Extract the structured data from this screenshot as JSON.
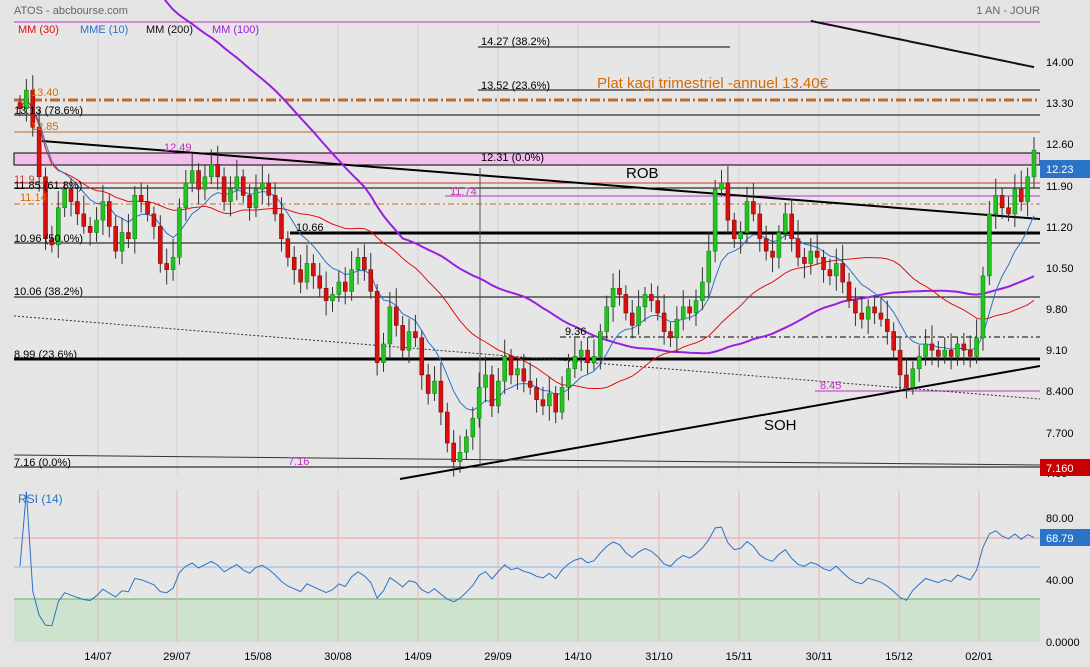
{
  "header": {
    "title": "ATOS - abcbourse.com",
    "period": "1 AN - JOUR"
  },
  "legend": [
    {
      "label": "MM (30)",
      "color": "#e01010"
    },
    {
      "label": "MME (10)",
      "color": "#2a73c8"
    },
    {
      "label": "MM (200)",
      "color": "#111111"
    },
    {
      "label": "MM (100)",
      "color": "#9a1ee0"
    }
  ],
  "price_axis": {
    "ticks": [
      "14.00",
      "13.30",
      "12.60",
      "11.90",
      "11.20",
      "10.50",
      "9.80",
      "9.10",
      "8.400",
      "7.700",
      "7.00"
    ],
    "last_price_label": "12.23",
    "low_price_label": "7.160"
  },
  "rsi": {
    "title": "RSI (14)",
    "ticks": [
      "80.00",
      "40.00",
      "0.0000"
    ],
    "value_label": "68.79"
  },
  "x_axis": {
    "labels": [
      "14/07",
      "29/07",
      "15/08",
      "30/08",
      "14/09",
      "29/09",
      "14/10",
      "31/10",
      "15/11",
      "30/11",
      "15/12",
      "02/01"
    ]
  },
  "fib_labels": {
    "f14_27": "14.27  (38.2%)",
    "f13_52": "13.52  (23.6%)",
    "f13_13": "13.13  (78.6%)",
    "f12_31": "12.31  (0.0%)",
    "f11_85": "11.85  (61.8%)",
    "f10_96": "10.96  (50.0%)",
    "f10_06": "10.06  (38.2%)",
    "f8_99": "8.99  (23.6%)",
    "f7_16": "7.16  (0.0%)"
  },
  "annotations": {
    "kagi": "Plat kagi trimestriel -annuel 13.40€",
    "rob": "ROB",
    "soh": "SOH",
    "lvl_13_40": "13.40",
    "lvl_12_85": "12.85",
    "lvl_12_49": "12.49",
    "lvl_11_9": "11.9",
    "lvl_11_74": "11.74",
    "lvl_11_14": "11.14",
    "lvl_10_66": "10.66",
    "lvl_9_36": "9.36",
    "lvl_8_45": "8.45",
    "lvl_7_16": "7.16"
  },
  "chart_data": {
    "type": "candlestick",
    "title": "ATOS - abcbourse.com",
    "period": "1 AN - JOUR",
    "y_range": [
      7.0,
      14.3
    ],
    "x_labels": [
      "14/07",
      "29/07",
      "15/08",
      "30/08",
      "14/09",
      "29/09",
      "14/10",
      "31/10",
      "15/11",
      "30/11",
      "15/12",
      "02/01"
    ],
    "closes": [
      12.9,
      13.2,
      12.6,
      11.8,
      10.8,
      10.7,
      11.3,
      11.6,
      11.4,
      11.2,
      11.0,
      10.9,
      11.1,
      11.4,
      11.0,
      10.6,
      10.9,
      10.8,
      11.5,
      11.4,
      11.2,
      11.0,
      10.4,
      10.3,
      10.5,
      11.3,
      11.7,
      11.9,
      11.6,
      11.8,
      12.0,
      11.8,
      11.4,
      11.6,
      11.8,
      11.5,
      11.3,
      11.6,
      11.7,
      11.5,
      11.2,
      10.8,
      10.5,
      10.3,
      10.1,
      10.4,
      10.2,
      10.0,
      9.8,
      9.9,
      10.1,
      9.95,
      10.3,
      10.5,
      10.3,
      9.95,
      8.8,
      9.1,
      9.7,
      9.4,
      9.0,
      9.3,
      9.2,
      8.6,
      8.3,
      8.5,
      8.0,
      7.5,
      7.2,
      7.35,
      7.6,
      7.9,
      8.4,
      8.6,
      8.1,
      8.5,
      8.9,
      8.6,
      8.7,
      8.5,
      8.4,
      8.2,
      8.1,
      8.3,
      8.0,
      8.4,
      8.7,
      8.9,
      9.0,
      8.8,
      8.9,
      9.3,
      9.7,
      10.0,
      9.9,
      9.6,
      9.4,
      9.7,
      9.9,
      9.8,
      9.6,
      9.3,
      9.2,
      9.5,
      9.7,
      9.6,
      9.8,
      10.1,
      10.6,
      11.6,
      11.7,
      11.1,
      10.8,
      10.9,
      11.4,
      11.2,
      10.8,
      10.6,
      10.5,
      10.9,
      11.2,
      10.8,
      10.5,
      10.4,
      10.6,
      10.5,
      10.3,
      10.2,
      10.4,
      10.1,
      9.8,
      9.6,
      9.5,
      9.7,
      9.6,
      9.5,
      9.3,
      9.0,
      8.6,
      8.4,
      8.7,
      8.9,
      9.1,
      9.0,
      8.9,
      9.0,
      8.9,
      9.1,
      9.0,
      8.9,
      9.2,
      10.2,
      11.2,
      11.5,
      11.3,
      11.2,
      11.6,
      11.4,
      11.8,
      12.23
    ],
    "ma_30": "MM (30)",
    "ema_10": "MME (10)",
    "ma_200": "MM (200)",
    "ma_100": "MM (100)",
    "fibonacci": [
      {
        "value": 14.27,
        "label": "14.27  (38.2%)"
      },
      {
        "value": 13.52,
        "label": "13.52  (23.6%)"
      },
      {
        "value": 13.13,
        "label": "13.13  (78.6%)"
      },
      {
        "value": 12.31,
        "label": "12.31  (0.0%)"
      },
      {
        "value": 11.85,
        "label": "11.85  (61.8%)"
      },
      {
        "value": 10.96,
        "label": "10.96  (50.0%)"
      },
      {
        "value": 10.06,
        "label": "10.06  (38.2%)"
      },
      {
        "value": 8.99,
        "label": "8.99  (23.6%)"
      },
      {
        "value": 7.16,
        "label": "7.16  (0.0%)"
      }
    ],
    "levels": [
      13.4,
      12.85,
      12.49,
      11.9,
      11.74,
      11.14,
      10.66,
      9.36,
      8.45,
      7.16
    ],
    "last": 12.23,
    "rsi_last": 68.79
  }
}
